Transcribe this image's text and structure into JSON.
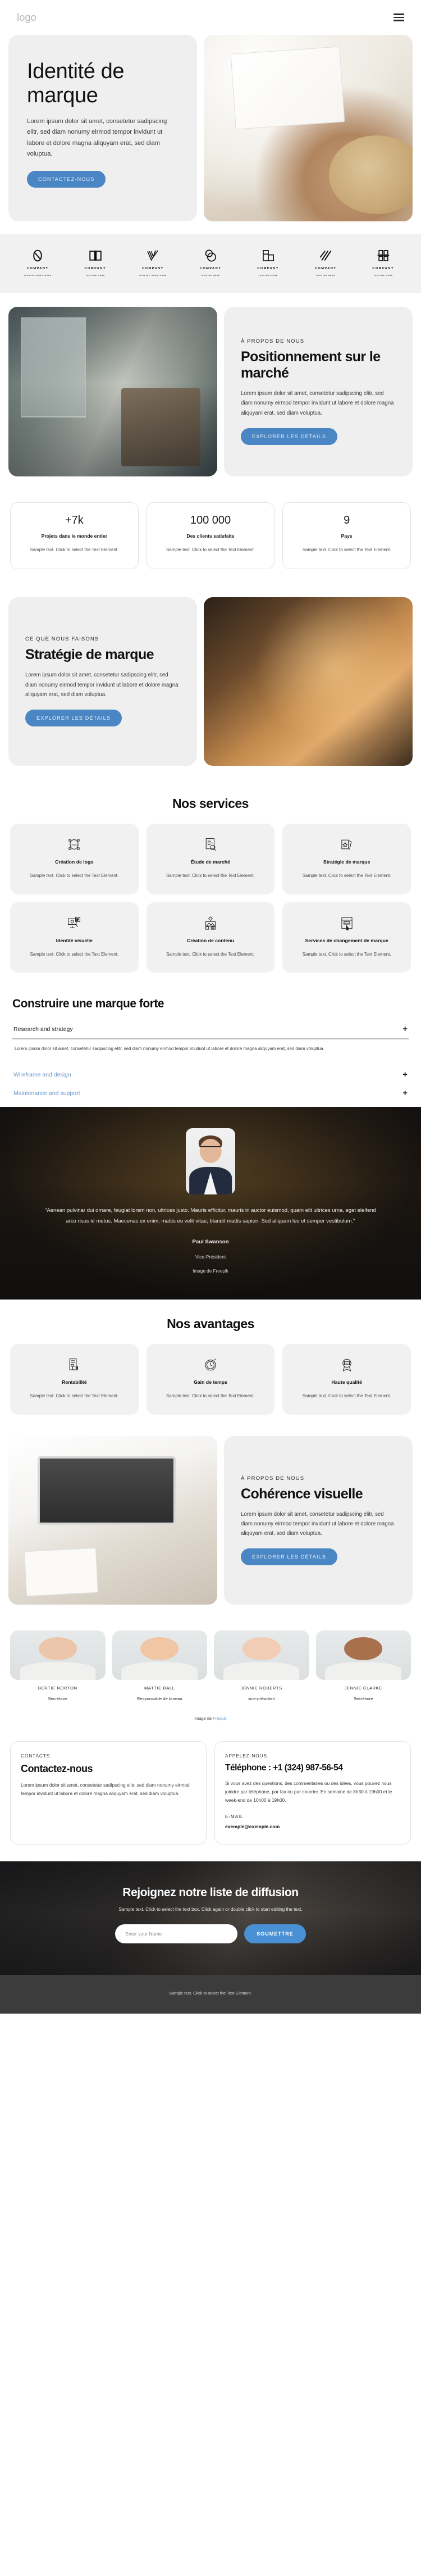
{
  "header": {
    "logo": "logo",
    "menu_icon": "hamburger-icon"
  },
  "hero": {
    "title": "Identité de marque",
    "body": "Lorem ipsum dolor sit amet, consetetur sadipscing elitr, sed diam nonumy eirmod tempor invidunt ut labore et dolore magna aliquyam erat, sed diam voluptua.",
    "cta": "CONTACTEZ-NOUS"
  },
  "partners": [
    {
      "name": "COMPANY",
      "tagline": "TAGLINE GOES HERE",
      "icon": "infinity-loop-logo"
    },
    {
      "name": "COMPANY",
      "tagline": "TAGLINE HERE",
      "icon": "open-book-logo"
    },
    {
      "name": "COMPANY",
      "tagline": "TAGLINE GOES HERE",
      "icon": "checkmark-lines-logo"
    },
    {
      "name": "COMPANY",
      "tagline": "TAGLINE HERE",
      "icon": "double-circle-logo"
    },
    {
      "name": "COMPANY",
      "tagline": "TAGLINE HERE",
      "icon": "square-corner-logo"
    },
    {
      "name": "COMPANY",
      "tagline": "TAGLINE HERE",
      "icon": "diagonal-stripes-logo"
    },
    {
      "name": "COMPANY",
      "tagline": "TAGLINE HERE",
      "icon": "letter-b-logo"
    }
  ],
  "market": {
    "eyebrow": "À PROPOS DE NOUS",
    "title": "Positionnement sur le marché",
    "body": "Lorem ipsum dolor sit amet, consetetur sadipscing elitr, sed diam nonumy eirmod tempor invidunt ut labore et dolore magna aliquyam erat, sed diam voluptua.",
    "cta": "EXPLORER LES DÉTAILS"
  },
  "stats": [
    {
      "number": "+7k",
      "label": "Projets dans le monde entier",
      "text": "Sample text. Click to select the Text Element."
    },
    {
      "number": "100 000",
      "label": "Des clients satisfaits",
      "text": "Sample text. Click to select the Text Element."
    },
    {
      "number": "9",
      "label": "Pays",
      "text": "Sample text. Click to select the Text Element."
    }
  ],
  "strategy": {
    "eyebrow": "CE QUE NOUS FAISONS",
    "title": "Stratégie de marque",
    "body": "Lorem ipsum dolor sit amet, consetetur sadipscing elitr, sed diam nonumy eirmod tempor invidunt ut labore et dolore magna aliquyam erat, sed diam voluptua.",
    "cta": "EXPLORER LES DÉTAILS"
  },
  "services": {
    "heading": "Nos services",
    "items": [
      {
        "title": "Création de logo",
        "text": "Sample text. Click to select the Text Element.",
        "icon": "logo-design-icon"
      },
      {
        "title": "Étude de marché",
        "text": "Sample text. Click to select the Text Element.",
        "icon": "market-research-icon"
      },
      {
        "title": "Stratégie de marque",
        "text": "Sample text. Click to select the Text Element.",
        "icon": "brand-strategy-icon"
      },
      {
        "title": "Identité visuelle",
        "text": "Sample text. Click to select the Text Element.",
        "icon": "visual-identity-icon"
      },
      {
        "title": "Création de contenu",
        "text": "Sample text. Click to select the Text Element.",
        "icon": "content-creation-icon"
      },
      {
        "title": "Services de changement de marque",
        "text": "Sample text. Click to select the Text Element.",
        "icon": "rebranding-icon"
      }
    ]
  },
  "accordion": {
    "heading": "Construire une marque forte",
    "items": [
      {
        "label": "Research and strategy",
        "open": true,
        "body": "Lorem ipsum dolor sit amet, consetetur sadipscing elitr, sed diam nonumy eirmod tempor invidunt ut labore et dolore magna aliquyam erat, sed diam voluptua."
      },
      {
        "label": "Wireframe and design",
        "open": false,
        "body": ""
      },
      {
        "label": "Maintenance and support",
        "open": false,
        "body": ""
      }
    ],
    "toggle_glyph": "+"
  },
  "testimonial": {
    "quote": "\"Aenean pulvinar dui ornare, feugiat lorem non, ultrices justo. Mauris efficitur, mauris in auctor euismod, quam elit ultrices urna, eget eleifend arcu risus id metus. Maecenas ex enim, mattis eu velit vitae, blandit mattis sapien. Sed aliquam leo et semper vestibulum.\"",
    "name": "Paul Swanson",
    "role": "Vice-Président",
    "credit_prefix": "Image de ",
    "credit_link": "Freepik"
  },
  "advantages": {
    "heading": "Nos avantages",
    "items": [
      {
        "title": "Rentabilité",
        "text": "Sample text. Click to select the Text Element.",
        "icon": "cost-efficiency-icon"
      },
      {
        "title": "Gain de temps",
        "text": "Sample text. Click to select the Text Element.",
        "icon": "time-saving-clock-icon"
      },
      {
        "title": "Haute qualité",
        "text": "Sample text. Click to select the Text Element.",
        "icon": "high-quality-badge-icon"
      }
    ]
  },
  "coherence": {
    "eyebrow": "À PROPOS DE NOUS",
    "title": "Cohérence visuelle",
    "body": "Lorem ipsum dolor sit amet, consetetur sadipscing elitr, sed diam nonumy eirmod tempor invidunt ut labore et dolore magna aliquyam erat, sed diam voluptua.",
    "cta": "EXPLORER LES DÉTAILS"
  },
  "team": {
    "members": [
      {
        "name": "BERTIE NORTON",
        "role": "Secrétaire",
        "skin": "#ecc6ab",
        "hair": "#d9c08d"
      },
      {
        "name": "MATTIE BALL",
        "role": "Responsable de bureau",
        "skin": "#f0c6a5",
        "hair": "#c4622a"
      },
      {
        "name": "JENNIE ROBERTS",
        "role": "vice-président",
        "skin": "#f0cdb4",
        "hair": "#8d6542"
      },
      {
        "name": "JENNIE CLARKE",
        "role": "Secrétaire",
        "skin": "#a9704c",
        "hair": "#2f2018"
      }
    ],
    "credit_prefix": "Image de ",
    "credit_link": "Freepik"
  },
  "contact": {
    "left": {
      "eyebrow": "CONTACTS",
      "title": "Contactez-nous",
      "body": "Lorem ipsum dolor sit amet, consetetur sadipscing elitr, sed diam nonumy eirmod tempor invidunt ut labore et dolore magna aliquyam erat, sed diam voluptua."
    },
    "right": {
      "eyebrow": "APPELEZ-NOUS",
      "title": "Téléphone : +1 (324) 987-56-54",
      "body": "Si vous avez des questions, des commentaires ou des idées, vous pouvez nous joindre par téléphone, par fax ou par courrier. En semaine de 8h30 à 19h00 et le week-end de 10h00 à 19h00.",
      "email_label": "E-MAIL",
      "email": "exemple@exemple.com"
    }
  },
  "newsletter": {
    "title": "Rejoignez notre liste de diffusion",
    "subtitle": "Sample text. Click to select the text box. Click again or double click to start editing the text.",
    "input_placeholder": "Enter your Name",
    "input_value": "",
    "submit": "SOUMETTRE"
  },
  "footer": {
    "text": "Sample text. Click to select the Text Element."
  },
  "colors": {
    "accent": "#4a86c4",
    "accent_button": "#4a90d4",
    "panel": "#efefef",
    "card": "#f1f1f1",
    "footer_bg": "#3c3c3c",
    "link": "#6d9bc8"
  }
}
